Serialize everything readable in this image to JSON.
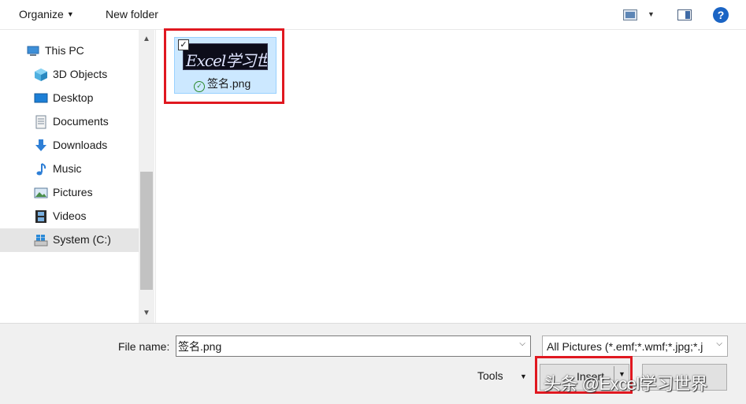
{
  "toolbar": {
    "organize_label": "Organize",
    "new_folder_label": "New folder",
    "help_label": "?"
  },
  "nav": {
    "items": [
      {
        "label": "This PC",
        "icon": "this-pc-icon"
      },
      {
        "label": "3D Objects",
        "icon": "3d-objects-icon"
      },
      {
        "label": "Desktop",
        "icon": "desktop-icon"
      },
      {
        "label": "Documents",
        "icon": "documents-icon"
      },
      {
        "label": "Downloads",
        "icon": "downloads-icon"
      },
      {
        "label": "Music",
        "icon": "music-icon"
      },
      {
        "label": "Pictures",
        "icon": "pictures-icon"
      },
      {
        "label": "Videos",
        "icon": "videos-icon"
      },
      {
        "label": "System (C:)",
        "icon": "drive-icon",
        "selected": true
      }
    ]
  },
  "files": [
    {
      "name": "签名.png",
      "thumbnail_text": "Excel学习世界",
      "checked": true,
      "selected": true,
      "status": "synced"
    }
  ],
  "bottom": {
    "file_name_label": "File name:",
    "file_name_value": "签名.png",
    "filter_value": "All Pictures (*.emf;*.wmf;*.jpg;*.j",
    "tools_label": "Tools",
    "insert_label": "Insert"
  },
  "watermark": "头条 @Excel学习世界",
  "colors": {
    "accent": "#1a64c4",
    "selection": "#cce8ff",
    "highlight_box": "#e01820"
  }
}
